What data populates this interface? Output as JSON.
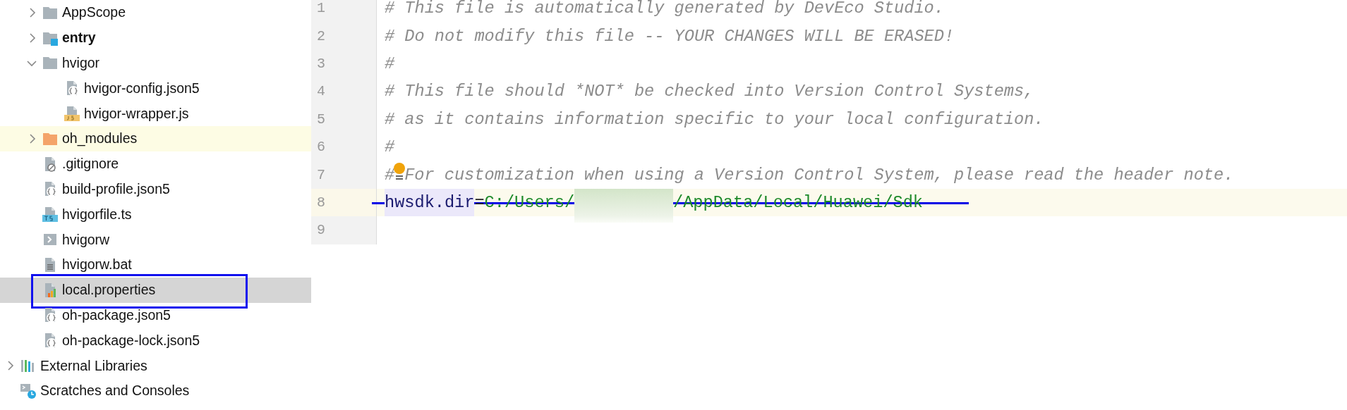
{
  "project_tree": [
    {
      "label": "AppScope",
      "kind": "folder",
      "expanded": false,
      "bold": false,
      "selected": false,
      "hovered": false,
      "boxed": false
    },
    {
      "label": "entry",
      "kind": "module",
      "expanded": false,
      "bold": true,
      "selected": false,
      "hovered": false,
      "boxed": false
    },
    {
      "label": "hvigor",
      "kind": "folder",
      "expanded": true,
      "bold": false,
      "selected": false,
      "hovered": false,
      "boxed": false,
      "children": [
        {
          "label": "hvigor-config.json5",
          "kind": "json",
          "bold": false,
          "selected": false,
          "hovered": false,
          "boxed": false
        },
        {
          "label": "hvigor-wrapper.js",
          "kind": "js",
          "bold": false,
          "selected": false,
          "hovered": false,
          "boxed": false
        }
      ]
    },
    {
      "label": "oh_modules",
      "kind": "library-folder",
      "expanded": false,
      "bold": false,
      "selected": false,
      "hovered": true,
      "boxed": false
    },
    {
      "label": ".gitignore",
      "kind": "ignore",
      "bold": false,
      "selected": false,
      "hovered": false,
      "boxed": false
    },
    {
      "label": "build-profile.json5",
      "kind": "json",
      "bold": false,
      "selected": false,
      "hovered": false,
      "boxed": false
    },
    {
      "label": "hvigorfile.ts",
      "kind": "ts",
      "bold": false,
      "selected": false,
      "hovered": false,
      "boxed": false
    },
    {
      "label": "hvigorw",
      "kind": "shell",
      "bold": false,
      "selected": false,
      "hovered": false,
      "boxed": false
    },
    {
      "label": "hvigorw.bat",
      "kind": "text",
      "bold": false,
      "selected": false,
      "hovered": false,
      "boxed": false
    },
    {
      "label": "local.properties",
      "kind": "properties",
      "bold": false,
      "selected": true,
      "hovered": false,
      "boxed": true
    },
    {
      "label": "oh-package.json5",
      "kind": "json",
      "bold": false,
      "selected": false,
      "hovered": false,
      "boxed": false
    },
    {
      "label": "oh-package-lock.json5",
      "kind": "json",
      "bold": false,
      "selected": false,
      "hovered": false,
      "boxed": false
    }
  ],
  "root_nodes": [
    {
      "label": "External Libraries",
      "kind": "libraries",
      "expanded": false,
      "bold": false,
      "selected": false,
      "hovered": false,
      "boxed": false
    },
    {
      "label": "Scratches and Consoles",
      "kind": "scratches",
      "bold": false,
      "selected": false,
      "hovered": false,
      "boxed": false
    }
  ],
  "editor": {
    "lines": [
      {
        "number": "1",
        "current": false,
        "struck": false,
        "tokens": [
          {
            "kind": "comment",
            "text": "# This file is automatically generated by DevEco Studio."
          }
        ]
      },
      {
        "number": "2",
        "current": false,
        "struck": false,
        "tokens": [
          {
            "kind": "comment",
            "text": "# Do not modify this file -- YOUR CHANGES WILL BE ERASED!"
          }
        ]
      },
      {
        "number": "3",
        "current": false,
        "struck": false,
        "tokens": [
          {
            "kind": "comment",
            "text": "#"
          }
        ]
      },
      {
        "number": "4",
        "current": false,
        "struck": false,
        "tokens": [
          {
            "kind": "comment",
            "text": "# This file should *NOT* be checked into Version Control Systems,"
          }
        ]
      },
      {
        "number": "5",
        "current": false,
        "struck": false,
        "tokens": [
          {
            "kind": "comment",
            "text": "# as it contains information specific to your local configuration."
          }
        ]
      },
      {
        "number": "6",
        "current": false,
        "struck": false,
        "tokens": [
          {
            "kind": "comment",
            "text": "#"
          }
        ]
      },
      {
        "number": "7",
        "current": false,
        "struck": false,
        "tokens": [
          {
            "kind": "comment",
            "text": "#"
          },
          {
            "kind": "bulb"
          },
          {
            "kind": "comment",
            "text": "For customization when using a Version Control System, please read the header note."
          }
        ]
      },
      {
        "number": "8",
        "current": true,
        "struck": true,
        "tokens": [
          {
            "kind": "key",
            "text": "hwsdk.dir"
          },
          {
            "kind": "operator",
            "text": "="
          },
          {
            "kind": "value",
            "text": "C:/Users/"
          },
          {
            "kind": "redacted"
          },
          {
            "kind": "value",
            "text": "/AppData/Local/Huawei/Sdk"
          }
        ]
      },
      {
        "number": "9",
        "current": false,
        "struck": false
      }
    ]
  }
}
